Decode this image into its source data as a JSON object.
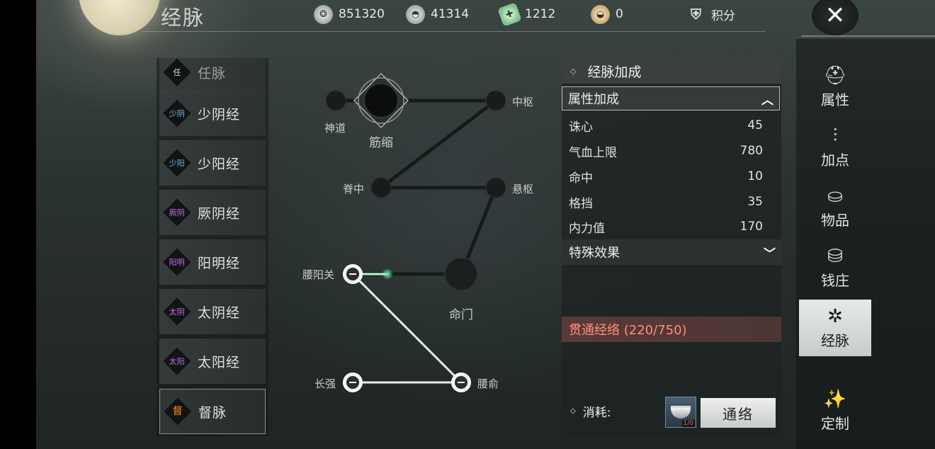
{
  "header": {
    "title": "经脉",
    "close_icon": "close-x-icon",
    "currencies": [
      {
        "name": "silver-coin",
        "value": "851320"
      },
      {
        "name": "ingot",
        "value": "41314"
      },
      {
        "name": "jade-plus",
        "value": "1212"
      },
      {
        "name": "pouch",
        "value": "0"
      }
    ],
    "points_label": "积分"
  },
  "meridians": {
    "items": [
      {
        "badge": "任",
        "label": "任脉",
        "badge_color": "#e0e0e0"
      },
      {
        "badge": "少阴",
        "label": "少阴经",
        "badge_color": "#6fb9e6"
      },
      {
        "badge": "少阳",
        "label": "少阳经",
        "badge_color": "#6fb9e6"
      },
      {
        "badge": "厥阴",
        "label": "厥阴经",
        "badge_color": "#c06fe0"
      },
      {
        "badge": "阳明",
        "label": "阳明经",
        "badge_color": "#c06fe0"
      },
      {
        "badge": "太阴",
        "label": "太阴经",
        "badge_color": "#c06fe0"
      },
      {
        "badge": "太阳",
        "label": "太阳经",
        "badge_color": "#c06fe0"
      },
      {
        "badge": "督",
        "label": "督脉",
        "badge_color": "#ff8a2a",
        "selected": true
      }
    ]
  },
  "diagram": {
    "nodes": {
      "shendao": "神道",
      "jinsuo": "筋缩",
      "zhongshu": "中枢",
      "jizhong": "脊中",
      "xuanshu": "悬枢",
      "yaoyangguan": "腰阳关",
      "mingmen": "命门",
      "changqiang": "长强",
      "yaoshu": "腰俞"
    }
  },
  "panel": {
    "title": "经脉加成",
    "attr_section": "属性加成",
    "stats": [
      {
        "name": "诛心",
        "value": "45"
      },
      {
        "name": "气血上限",
        "value": "780"
      },
      {
        "name": "命中",
        "value": "10"
      },
      {
        "name": "格挡",
        "value": "35"
      },
      {
        "name": "内力值",
        "value": "170"
      }
    ],
    "special_section": "特殊效果",
    "progress_text": "贯通经络 (220/750)",
    "cost_label": "消耗:",
    "cost_qty": "1/0",
    "tong_label": "通络"
  },
  "sidebar": {
    "items": [
      {
        "label": "属性",
        "icon": "hat-icon"
      },
      {
        "label": "加点",
        "icon": "sliders-icon"
      },
      {
        "label": "物品",
        "icon": "bag-icon"
      },
      {
        "label": "钱庄",
        "icon": "money-bag-icon"
      },
      {
        "label": "经脉",
        "icon": "meridian-icon",
        "selected": true
      },
      {
        "label": "定制",
        "icon": "magic-wand-icon"
      }
    ]
  }
}
